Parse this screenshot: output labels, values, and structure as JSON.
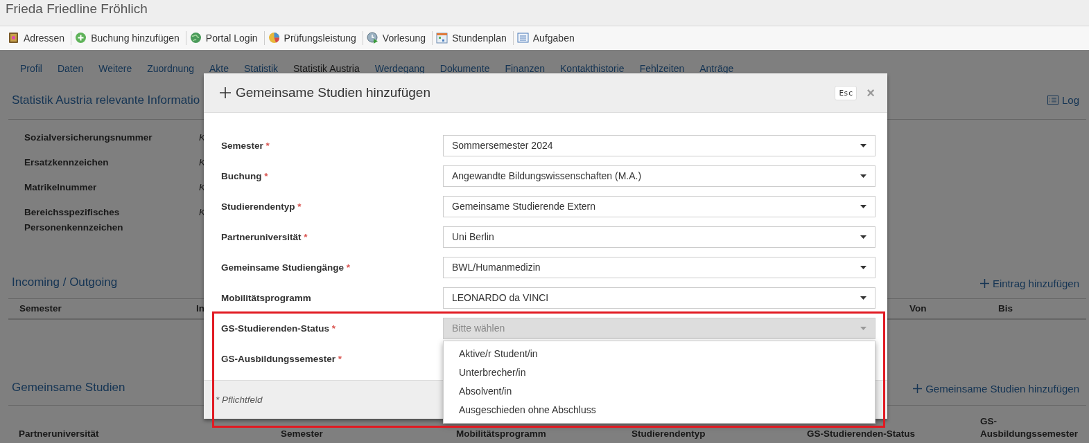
{
  "window": {
    "title": "Frieda Friedline Fröhlich"
  },
  "toolbar": [
    {
      "kind": "book",
      "label": "Adressen"
    },
    {
      "kind": "plus",
      "label": "Buchung hinzufügen"
    },
    {
      "kind": "globe",
      "label": "Portal Login"
    },
    {
      "kind": "chart",
      "label": "Prüfungsleistung"
    },
    {
      "kind": "play",
      "label": "Vorlesung"
    },
    {
      "kind": "calendar",
      "label": "Stundenplan"
    },
    {
      "kind": "list",
      "label": "Aufgaben"
    }
  ],
  "tabs": [
    {
      "label": "Profil",
      "selected": false
    },
    {
      "label": "Daten",
      "selected": false
    },
    {
      "label": "Weitere",
      "selected": false
    },
    {
      "label": "Zuordnung",
      "selected": false
    },
    {
      "label": "Akte",
      "selected": false
    },
    {
      "label": "Statistik",
      "selected": false
    },
    {
      "label": "Statistik Austria",
      "selected": true
    },
    {
      "label": "Werdegang",
      "selected": false
    },
    {
      "label": "Dokumente",
      "selected": false
    },
    {
      "label": "Finanzen",
      "selected": false
    },
    {
      "label": "Kontakthistorie",
      "selected": false
    },
    {
      "label": "Fehlzeiten",
      "selected": false
    },
    {
      "label": "Anträge",
      "selected": false
    }
  ],
  "statistik_section": {
    "heading": "Statistik Austria relevante Informatio",
    "log_link": "Log",
    "fields": [
      {
        "label": "Sozialversicherungsnummer",
        "value": "K"
      },
      {
        "label": "Ersatzkennzeichen",
        "value": "K"
      },
      {
        "label": "Matrikelnummer",
        "value": "K"
      },
      {
        "label": "Bereichsspezifisches Personenkennzeichen",
        "value": "K"
      }
    ]
  },
  "incoming_section": {
    "heading": "Incoming / Outgoing",
    "add_link": "Eintrag hinzufügen",
    "columns": [
      "Semester",
      "In",
      "Von",
      "Bis"
    ]
  },
  "gemeinsame_section": {
    "heading": "Gemeinsame Studien",
    "add_link": "Gemeinsame Studien hinzufügen",
    "columns": [
      "Partneruniversität",
      "Semester",
      "Mobilitätsprogramm",
      "Studierendentyp",
      "GS-Studierenden-Status",
      "GS-Ausbildungssemester"
    ]
  },
  "modal": {
    "title": "Gemeinsame Studien hinzufügen",
    "esc_key": "Esc",
    "close": "×",
    "fields": [
      {
        "label": "Semester",
        "required": true,
        "value": "Sommersemester 2024",
        "disabled": false
      },
      {
        "label": "Buchung",
        "required": true,
        "value": "Angewandte Bildungswissenschaften (M.A.)",
        "disabled": false
      },
      {
        "label": "Studierendentyp",
        "required": true,
        "value": "Gemeinsame Studierende Extern",
        "disabled": false
      },
      {
        "label": "Partneruniversität",
        "required": true,
        "value": "Uni Berlin",
        "disabled": false
      },
      {
        "label": "Gemeinsame Studiengänge",
        "required": true,
        "value": "BWL/Humanmedizin",
        "disabled": false
      },
      {
        "label": "Mobilitätsprogramm",
        "required": false,
        "value": "LEONARDO da VINCI",
        "disabled": false
      },
      {
        "label": "GS-Studierenden-Status",
        "required": true,
        "placeholder": "Bitte wählen",
        "disabled": true,
        "options": [
          {
            "label": "Aktive/r Student/in",
            "selected": false
          },
          {
            "label": "Unterbrecher/in",
            "selected": false
          },
          {
            "label": "Absolvent/in",
            "selected": false
          },
          {
            "label": "Ausgeschieden ohne Abschluss",
            "selected": false
          }
        ]
      },
      {
        "label": "GS-Ausbildungssemester",
        "required": true
      }
    ],
    "footer_note": "* Pflichtfeld",
    "required_mark": "*"
  },
  "highlight_frame": true
}
